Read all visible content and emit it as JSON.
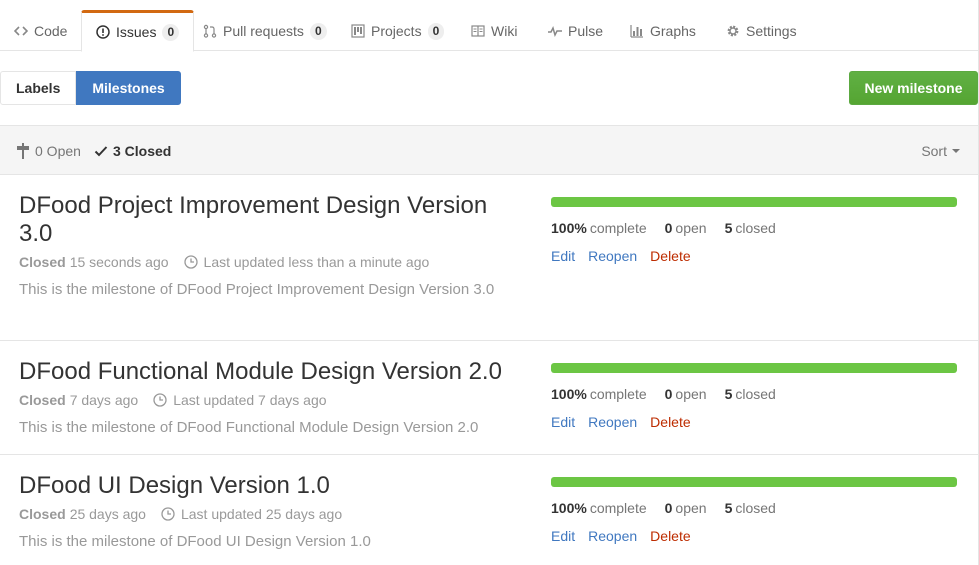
{
  "tabs": [
    {
      "label": "Code",
      "icon": "code-icon"
    },
    {
      "label": "Issues",
      "icon": "issue-opened-icon",
      "count": "0"
    },
    {
      "label": "Pull requests",
      "icon": "pull-request-icon",
      "count": "0"
    },
    {
      "label": "Projects",
      "icon": "project-icon",
      "count": "0"
    },
    {
      "label": "Wiki",
      "icon": "book-icon"
    },
    {
      "label": "Pulse",
      "icon": "pulse-icon"
    },
    {
      "label": "Graphs",
      "icon": "graph-icon"
    },
    {
      "label": "Settings",
      "icon": "gear-icon"
    }
  ],
  "subnav": {
    "labels": "Labels",
    "milestones": "Milestones"
  },
  "new_milestone_button": "New milestone",
  "list_header": {
    "open": "0 Open",
    "closed": "3 Closed",
    "sort": "Sort"
  },
  "milestones": [
    {
      "title": "DFood Project Improvement Design Version 3.0",
      "closed_label": "Closed",
      "closed_ago": "15 seconds ago",
      "updated": "Last updated less than a minute ago",
      "description": "This is the milestone of DFood Project Improvement Design Version 3.0",
      "progress": 100,
      "percent": "100%",
      "complete": "complete",
      "open_count": "0",
      "open_label": "open",
      "closed_count": "5",
      "closed_word": "closed",
      "edit": "Edit",
      "reopen": "Reopen",
      "delete": "Delete"
    },
    {
      "title": "DFood Functional Module Design Version 2.0",
      "closed_label": "Closed",
      "closed_ago": "7 days ago",
      "updated": "Last updated 7 days ago",
      "description": "This is the milestone of DFood Functional Module Design Version 2.0",
      "progress": 100,
      "percent": "100%",
      "complete": "complete",
      "open_count": "0",
      "open_label": "open",
      "closed_count": "5",
      "closed_word": "closed",
      "edit": "Edit",
      "reopen": "Reopen",
      "delete": "Delete"
    },
    {
      "title": "DFood UI Design Version 1.0",
      "closed_label": "Closed",
      "closed_ago": "25 days ago",
      "updated": "Last updated 25 days ago",
      "description": "This is the milestone of DFood UI Design Version 1.0",
      "progress": 100,
      "percent": "100%",
      "complete": "complete",
      "open_count": "0",
      "open_label": "open",
      "closed_count": "5",
      "closed_word": "closed",
      "edit": "Edit",
      "reopen": "Reopen",
      "delete": "Delete"
    }
  ],
  "colors": {
    "accent": "#4078c0",
    "progress": "#6cc644",
    "danger": "#bd2c00",
    "tab_active": "#d26911"
  }
}
